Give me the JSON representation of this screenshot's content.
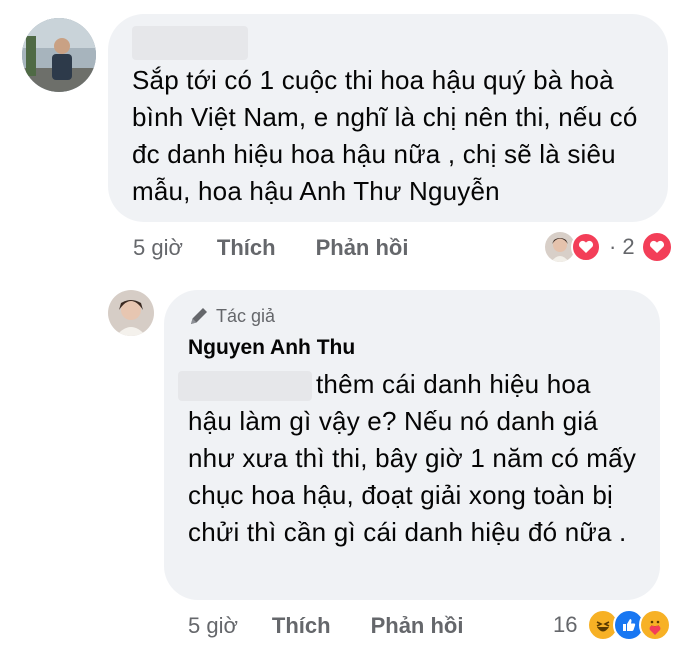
{
  "comment1": {
    "text": "Sắp tới có 1 cuộc thi hoa hậu quý bà hoà bình Việt Nam, e nghĩ là chị nên thi, nếu có đc danh hiệu hoa hậu nữa , chị sẽ là siêu mẫu, hoa hậu Anh Thư Nguyễn",
    "time": "5 giờ",
    "like_label": "Thích",
    "reply_label": "Phản hồi",
    "reaction_sep": "·",
    "reaction_count": "2"
  },
  "reply": {
    "author_badge": "Tác giả",
    "author_name": "Nguyen Anh Thu",
    "text": "thêm cái danh hiệu hoa hậu làm gì vậy e? Nếu nó danh giá như xưa thì thi, bây giờ 1 năm có mấy chục hoa hậu, đoạt giải xong toàn bị chửi thì cần gì cái danh hiệu đó nữa .",
    "time": "5 giờ",
    "like_label": "Thích",
    "reply_label": "Phản hồi",
    "reaction_count": "16"
  },
  "colors": {
    "bubble": "#f0f2f5",
    "meta_text": "#65676b",
    "love_red": "#f33e58",
    "like_blue": "#1877f2",
    "haha_yellow": "#f7b125"
  },
  "icons": [
    "pencil-icon",
    "love-reaction-icon",
    "haha-reaction-icon",
    "like-reaction-icon",
    "care-reaction-icon"
  ]
}
